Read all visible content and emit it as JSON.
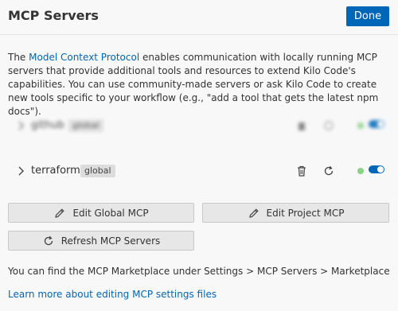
{
  "header": {
    "title": "MCP Servers",
    "done_label": "Done"
  },
  "intro": {
    "prefix": "The ",
    "link": "Model Context Protocol",
    "suffix": " enables communication with locally running MCP servers that provide additional tools and resources to extend Kilo Code's capabilities. You can use community-made servers or ask Kilo Code to create new tools specific to your workflow (e.g., \"add a tool that gets the latest npm docs\")."
  },
  "servers": [
    {
      "name": "github",
      "scope": "global",
      "enabled": true,
      "status": "connected",
      "blurred": true
    },
    {
      "name": "terraform",
      "scope": "global",
      "enabled": true,
      "status": "connected",
      "blurred": false
    }
  ],
  "buttons": {
    "edit_global": "Edit Global MCP",
    "edit_project": "Edit Project MCP",
    "refresh": "Refresh MCP Servers"
  },
  "footer": {
    "marketplace_note": "You can find the MCP Marketplace under Settings > MCP Servers > Marketplace",
    "learn_more": "Learn more about editing MCP settings files"
  },
  "colors": {
    "accent": "#0066b8",
    "status_connected": "#89d185",
    "badge_bg": "#dcdcdc"
  }
}
